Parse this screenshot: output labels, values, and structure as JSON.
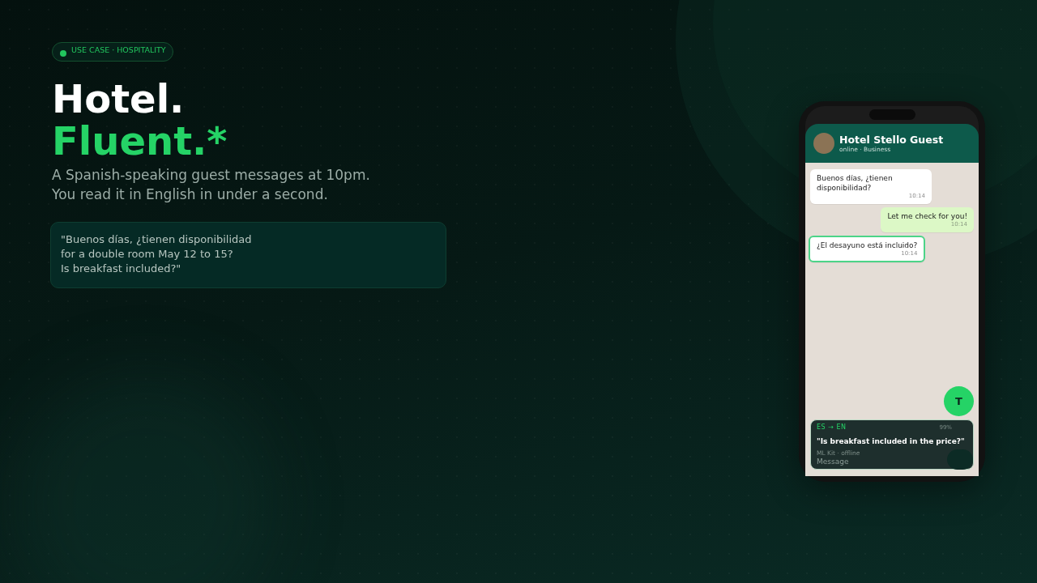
{
  "badge": {
    "label": "USE CASE · HOSPITALITY"
  },
  "headline": [
    {
      "text": "Hotel.",
      "accent": false
    },
    {
      "text": "Fluent.*",
      "accent": true
    }
  ],
  "subtitle": [
    "A Spanish-speaking guest messages at 10pm.",
    "You read it in English in under a second."
  ],
  "quote": [
    "\"Buenos días, ¿tienen disponibilidad",
    "for a double room May 12 to 15?",
    "Is breakfast included?\""
  ],
  "phone": {
    "chat_header": {
      "name": "Hotel Stello Guest",
      "status": "online · Business"
    },
    "messages": [
      {
        "kind": "incoming",
        "text": "Buenos días, ¿tienen disponibilidad?",
        "time": "10:14",
        "highlighted": false
      },
      {
        "kind": "outgoing",
        "text": "Let me check for you!",
        "time": "10:14",
        "highlighted": false
      },
      {
        "kind": "incoming",
        "text": "¿El desayuno está incluido?",
        "time": "10:14",
        "highlighted": true
      }
    ],
    "fab": {
      "label": "T"
    },
    "translation": {
      "languages": "ES → EN",
      "confidence": "99%",
      "text": "\"Is breakfast included in the price?\"",
      "engine": "ML Kit · offline"
    },
    "composer": {
      "placeholder": "Message"
    }
  }
}
